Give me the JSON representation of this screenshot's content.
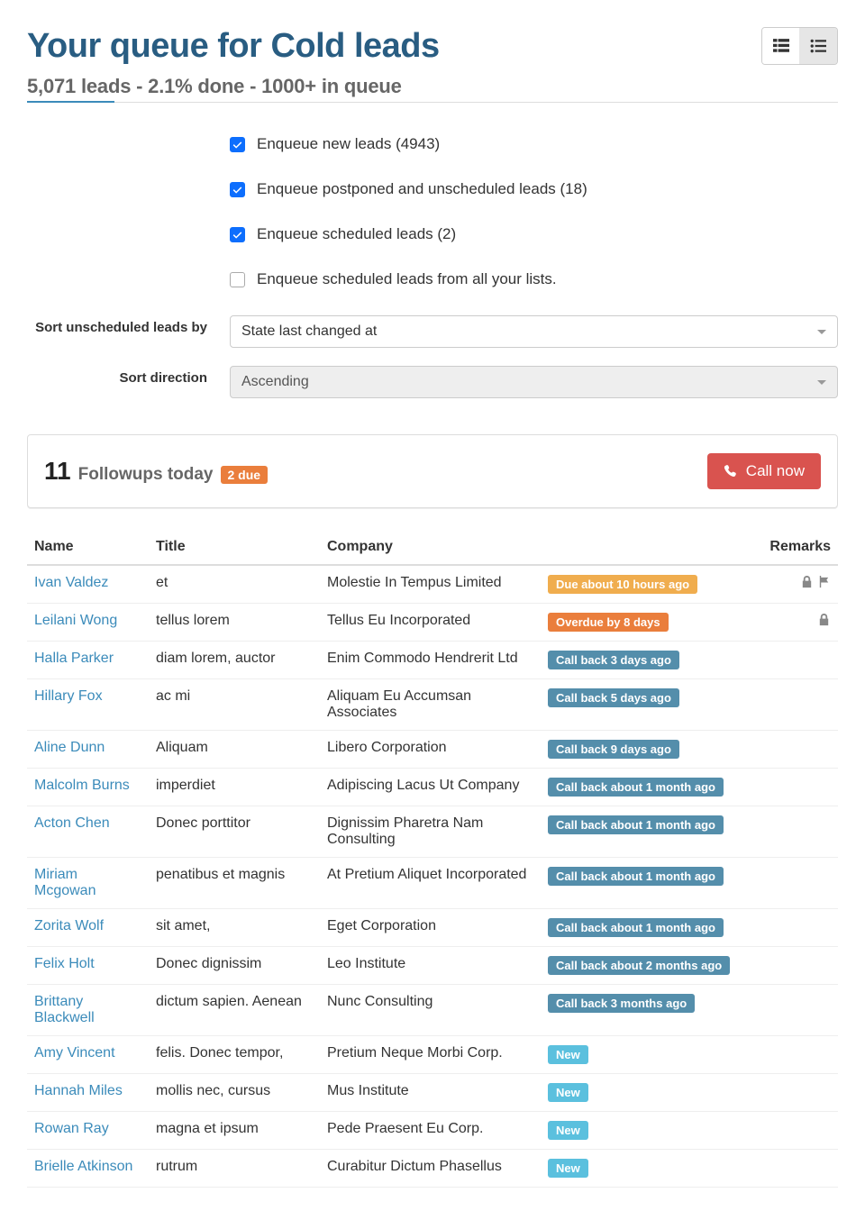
{
  "header": {
    "title": "Your queue for Cold leads",
    "subtitle": "5,071 leads - 2.1% done - 1000+ in queue"
  },
  "filters": {
    "cb1": "Enqueue new leads (4943)",
    "cb2": "Enqueue postponed and unscheduled leads (18)",
    "cb3": "Enqueue scheduled leads (2)",
    "cb4": "Enqueue scheduled leads from all your lists.",
    "sortLabel": "Sort unscheduled leads by",
    "sortValue": "State last changed at",
    "dirLabel": "Sort direction",
    "dirValue": "Ascending"
  },
  "followups": {
    "count": "11",
    "text": "Followups today",
    "due": "2 due",
    "call": "Call now"
  },
  "cols": {
    "name": "Name",
    "title": "Title",
    "company": "Company",
    "remarks": "Remarks"
  },
  "leads": [
    {
      "name": "Ivan Valdez",
      "title": "et",
      "company": "Molestie In Tempus Limited",
      "status": "Due about 10 hours ago",
      "statusClass": "st-warning",
      "lock": true,
      "flag": true
    },
    {
      "name": "Leilani Wong",
      "title": "tellus lorem",
      "company": "Tellus Eu Incorporated",
      "status": "Overdue by 8 days",
      "statusClass": "st-danger",
      "lock": true,
      "flag": false
    },
    {
      "name": "Halla Parker",
      "title": "diam lorem, auctor",
      "company": "Enim Commodo Hendrerit Ltd",
      "status": "Call back 3 days ago",
      "statusClass": "st-info",
      "lock": false,
      "flag": false
    },
    {
      "name": "Hillary Fox",
      "title": "ac mi",
      "company": "Aliquam Eu Accumsan Associates",
      "status": "Call back 5 days ago",
      "statusClass": "st-info",
      "lock": false,
      "flag": false
    },
    {
      "name": "Aline Dunn",
      "title": "Aliquam",
      "company": "Libero Corporation",
      "status": "Call back 9 days ago",
      "statusClass": "st-info",
      "lock": false,
      "flag": false
    },
    {
      "name": "Malcolm Burns",
      "title": "imperdiet",
      "company": "Adipiscing Lacus Ut Company",
      "status": "Call back about 1 month ago",
      "statusClass": "st-info",
      "lock": false,
      "flag": false
    },
    {
      "name": "Acton Chen",
      "title": "Donec porttitor",
      "company": "Dignissim Pharetra Nam Consulting",
      "status": "Call back about 1 month ago",
      "statusClass": "st-info",
      "lock": false,
      "flag": false
    },
    {
      "name": "Miriam Mcgowan",
      "title": "penatibus et magnis",
      "company": "At Pretium Aliquet Incorporated",
      "status": "Call back about 1 month ago",
      "statusClass": "st-info",
      "lock": false,
      "flag": false
    },
    {
      "name": "Zorita Wolf",
      "title": "sit amet,",
      "company": "Eget Corporation",
      "status": "Call back about 1 month ago",
      "statusClass": "st-info",
      "lock": false,
      "flag": false
    },
    {
      "name": "Felix Holt",
      "title": "Donec dignissim",
      "company": "Leo Institute",
      "status": "Call back about 2 months ago",
      "statusClass": "st-info",
      "lock": false,
      "flag": false
    },
    {
      "name": "Brittany Blackwell",
      "title": "dictum sapien. Aenean",
      "company": "Nunc Consulting",
      "status": "Call back 3 months ago",
      "statusClass": "st-info",
      "lock": false,
      "flag": false
    },
    {
      "name": "Amy Vincent",
      "title": "felis. Donec tempor,",
      "company": "Pretium Neque Morbi Corp.",
      "status": "New",
      "statusClass": "st-new",
      "lock": false,
      "flag": false
    },
    {
      "name": "Hannah Miles",
      "title": "mollis nec, cursus",
      "company": "Mus Institute",
      "status": "New",
      "statusClass": "st-new",
      "lock": false,
      "flag": false
    },
    {
      "name": "Rowan Ray",
      "title": "magna et ipsum",
      "company": "Pede Praesent Eu Corp.",
      "status": "New",
      "statusClass": "st-new",
      "lock": false,
      "flag": false
    },
    {
      "name": "Brielle Atkinson",
      "title": "rutrum",
      "company": "Curabitur Dictum Phasellus",
      "status": "New",
      "statusClass": "st-new",
      "lock": false,
      "flag": false
    }
  ]
}
